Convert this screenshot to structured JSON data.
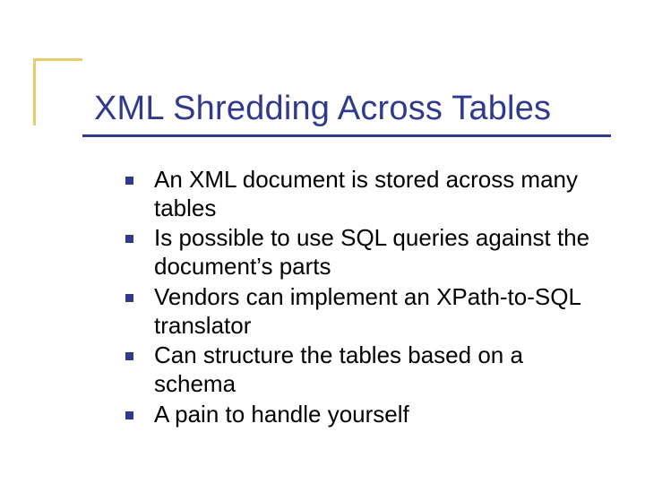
{
  "title": "XML Shredding Across Tables",
  "bullets": {
    "b0": "An XML document is stored across many tables",
    "b1": "Is possible to use SQL queries against the document’s parts",
    "b2": "Vendors can implement an XPath-to-SQL translator",
    "b3": "Can structure the tables based on a schema",
    "b4": "A pain to handle yourself"
  },
  "colors": {
    "accent_gold": "#e9cc6f",
    "accent_blue": "#2f3a8e"
  }
}
